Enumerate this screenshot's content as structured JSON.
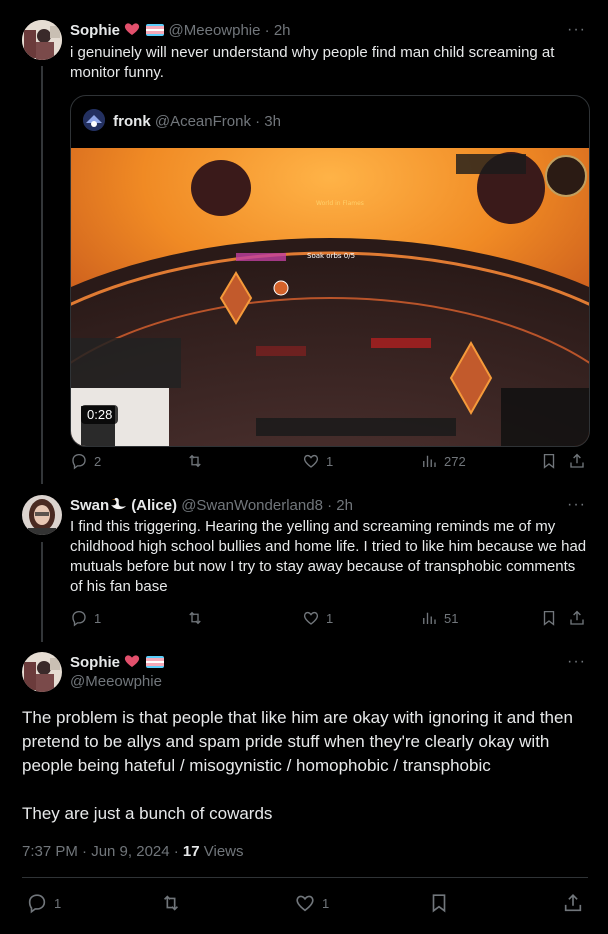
{
  "tweet1": {
    "name": "Sophie",
    "handle": "@Meeowphie",
    "time": "· 2h",
    "text": "i genuinely will never understand why people find man child screaming at monitor funny.",
    "quote": {
      "name": "fronk",
      "handle": "@AceanFronk",
      "time": "· 3h",
      "video_duration": "0:28",
      "game_text": {
        "world_in_flames": "World in Flames",
        "soak_orbs": "Soak orbs 0/5"
      }
    },
    "replies": "2",
    "retweets": "",
    "likes": "1",
    "views": "272"
  },
  "tweet2": {
    "name": "Swan",
    "name_suffix": "(Alice)",
    "handle": "@SwanWonderland8",
    "time": "· 2h",
    "text": "I find this triggering. Hearing the yelling and screaming reminds me of my childhood  high school bullies and home life. I tried to like him because we had mutuals before but now I try to stay away because of transphobic comments of his fan base",
    "replies": "1",
    "retweets": "",
    "likes": "1",
    "views": "51"
  },
  "tweet3": {
    "name": "Sophie",
    "handle": "@Meeowphie",
    "paragraph1": "The problem is that people that like him are okay with ignoring it and then pretend to be allys and spam pride stuff when they're clearly okay with people being hateful / misogynistic / homophobic / transphobic",
    "paragraph2": "They are just a bunch of cowards",
    "date": "7:37 PM · Jun 9, 2024 · ",
    "views_count": "17",
    "views_label": " Views",
    "replies": "1",
    "likes": "1"
  },
  "icons": {
    "reply": "reply-icon",
    "retweet": "retweet-icon",
    "like": "heart-icon",
    "views": "views-chart-icon",
    "bookmark": "bookmark-icon",
    "share": "share-icon",
    "more": "more-icon"
  },
  "colors": {
    "background": "#000000",
    "text": "#e7e9ea",
    "muted": "#71767b",
    "border": "#2f3336",
    "heart": "#e2506c",
    "trans_blue": "#5bcefa",
    "trans_pink": "#f5a9b8"
  }
}
